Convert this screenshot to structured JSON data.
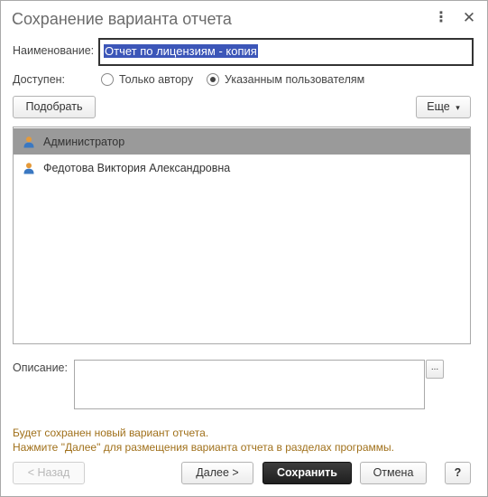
{
  "window": {
    "title": "Сохранение варианта отчета",
    "menu_icon": "⋮",
    "close_icon": "✕"
  },
  "form": {
    "name_label": "Наименование:",
    "name_value": "Отчет по лицензиям - копия",
    "available_label": "Доступен:",
    "radio_author": "Только автору",
    "radio_users": "Указанным пользователям",
    "selected_radio": "users"
  },
  "toolbar": {
    "pick_label": "Подобрать",
    "more_label": "Еще",
    "more_arrow": "▾"
  },
  "users": [
    {
      "name": "Администратор",
      "selected": true
    },
    {
      "name": "Федотова Виктория Александровна",
      "selected": false
    }
  ],
  "description": {
    "label": "Описание:",
    "value": "",
    "dots_label": "..."
  },
  "notes": {
    "line1": "Будет сохранен новый вариант отчета.",
    "line2": "Нажмите \"Далее\" для размещения варианта отчета в разделах программы."
  },
  "footer": {
    "back_label": "< Назад",
    "next_label": "Далее >",
    "save_label": "Сохранить",
    "cancel_label": "Отмена",
    "help_label": "?"
  },
  "colors": {
    "note": "#a0701a",
    "selected_row": "#9a9a9a",
    "selection": "#3c56b8",
    "user_icon": "#e59a3a"
  }
}
